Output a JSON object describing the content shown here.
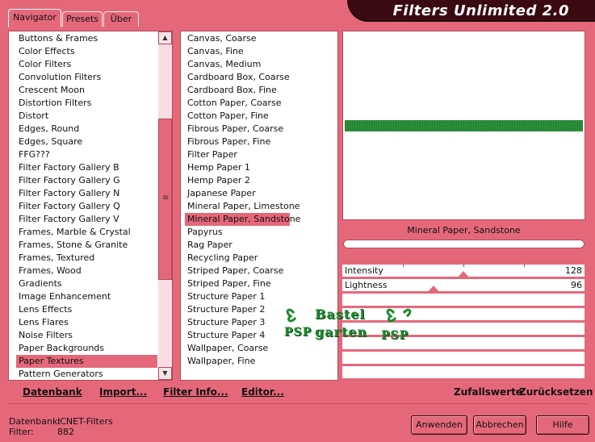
{
  "app": {
    "title": "Filters Unlimited 2.0"
  },
  "tabs": [
    {
      "label": "Navigator",
      "active": true
    },
    {
      "label": "Presets",
      "active": false
    },
    {
      "label": "Über",
      "active": false
    }
  ],
  "categories": {
    "items": [
      "Buttons & Frames",
      "Color Effects",
      "Color Filters",
      "Convolution Filters",
      "Crescent Moon",
      "Distortion Filters",
      "Distort",
      "Edges, Round",
      "Edges, Square",
      "FFG???",
      "Filter Factory Gallery B",
      "Filter Factory Gallery G",
      "Filter Factory Gallery N",
      "Filter Factory Gallery Q",
      "Filter Factory Gallery V",
      "Frames, Marble & Crystal",
      "Frames, Stone & Granite",
      "Frames, Textured",
      "Frames, Wood",
      "Gradients",
      "Image Enhancement",
      "Lens Effects",
      "Lens Flares",
      "Noise Filters",
      "Paper Backgrounds",
      "Paper Textures",
      "Pattern Generators"
    ],
    "selected": "Paper Textures"
  },
  "filters": {
    "items": [
      "Canvas, Coarse",
      "Canvas, Fine",
      "Canvas, Medium",
      "Cardboard Box, Coarse",
      "Cardboard Box, Fine",
      "Cotton Paper, Coarse",
      "Cotton Paper, Fine",
      "Fibrous Paper, Coarse",
      "Fibrous Paper, Fine",
      "Filter Paper",
      "Hemp Paper 1",
      "Hemp Paper 2",
      "Japanese Paper",
      "Mineral Paper, Limestone",
      "Mineral Paper, Sandstone",
      "Papyrus",
      "Rag Paper",
      "Recycling Paper",
      "Striped Paper, Coarse",
      "Striped Paper, Fine",
      "Structure Paper 1",
      "Structure Paper 2",
      "Structure Paper 3",
      "Structure Paper 4",
      "Wallpaper, Coarse",
      "Wallpaper, Fine"
    ],
    "selected": "Mineral Paper, Sandstone"
  },
  "preview": {
    "filter_name": "Mineral Paper, Sandstone",
    "stripe_color": "#1f8a2f"
  },
  "sliders": [
    {
      "label": "Intensity",
      "value": "128",
      "fraction": 0.5
    },
    {
      "label": "Lightness",
      "value": "96",
      "fraction": 0.375
    }
  ],
  "toolbar": {
    "database": "Datenbank",
    "import": "Import...",
    "filter_info": "Filter Info...",
    "editor": "Editor...",
    "random": "Zufallswerte",
    "reset": "Zurücksetzen"
  },
  "status": {
    "database_label": "Datenbank:",
    "database_value": "ICNET-Filters",
    "filter_label": "Filter:",
    "filter_value": "882"
  },
  "buttons": {
    "apply": "Anwenden",
    "cancel": "Abbrechen",
    "help": "Hilfe"
  },
  "watermark": {
    "line1": "Bastel",
    "line2": "garten",
    "badge": "PSP"
  },
  "colors": {
    "background": "#e5687a",
    "banner": "#3a0a10",
    "accent_green": "#1f8a2f"
  }
}
